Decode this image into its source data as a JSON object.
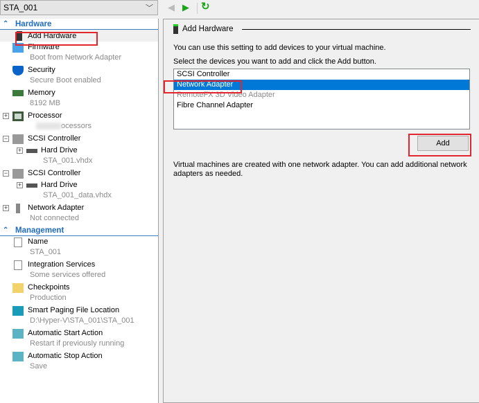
{
  "vm_selector": {
    "value": "STA_001"
  },
  "toolbar": {
    "back": "◀",
    "forward": "▶",
    "refresh": "↻"
  },
  "hardware": {
    "title": "Hardware",
    "items": [
      {
        "label": "Add Hardware",
        "sub": ""
      },
      {
        "label": "Firmware",
        "sub": "Boot from Network Adapter"
      },
      {
        "label": "Security",
        "sub": "Secure Boot enabled"
      },
      {
        "label": "Memory",
        "sub": "8192 MB"
      },
      {
        "label": "Processor",
        "sub": "ocessors"
      },
      {
        "label": "SCSI Controller",
        "sub": ""
      },
      {
        "label": "Hard Drive",
        "sub": "STA_001.vhdx"
      },
      {
        "label": "SCSI Controller",
        "sub": ""
      },
      {
        "label": "Hard Drive",
        "sub": "STA_001_data.vhdx"
      },
      {
        "label": "Network Adapter",
        "sub": "Not connected"
      }
    ]
  },
  "management": {
    "title": "Management",
    "items": [
      {
        "label": "Name",
        "sub": "STA_001"
      },
      {
        "label": "Integration Services",
        "sub": "Some services offered"
      },
      {
        "label": "Checkpoints",
        "sub": "Production"
      },
      {
        "label": "Smart Paging File Location",
        "sub": "D:\\Hyper-V\\STA_001\\STA_001"
      },
      {
        "label": "Automatic Start Action",
        "sub": "Restart if previously running"
      },
      {
        "label": "Automatic Stop Action",
        "sub": "Save"
      }
    ]
  },
  "panel": {
    "title": "Add Hardware",
    "intro": "You can use this setting to add devices to your virtual machine.",
    "instruction": "Select the devices you want to add and click the Add button.",
    "devices": [
      "SCSI Controller",
      "Network Adapter",
      "RemoteFX 3D Video Adapter",
      "Fibre Channel Adapter"
    ],
    "add_label": "Add",
    "note": "Virtual machines are created with one network adapter. You can add additional network adapters as needed."
  }
}
